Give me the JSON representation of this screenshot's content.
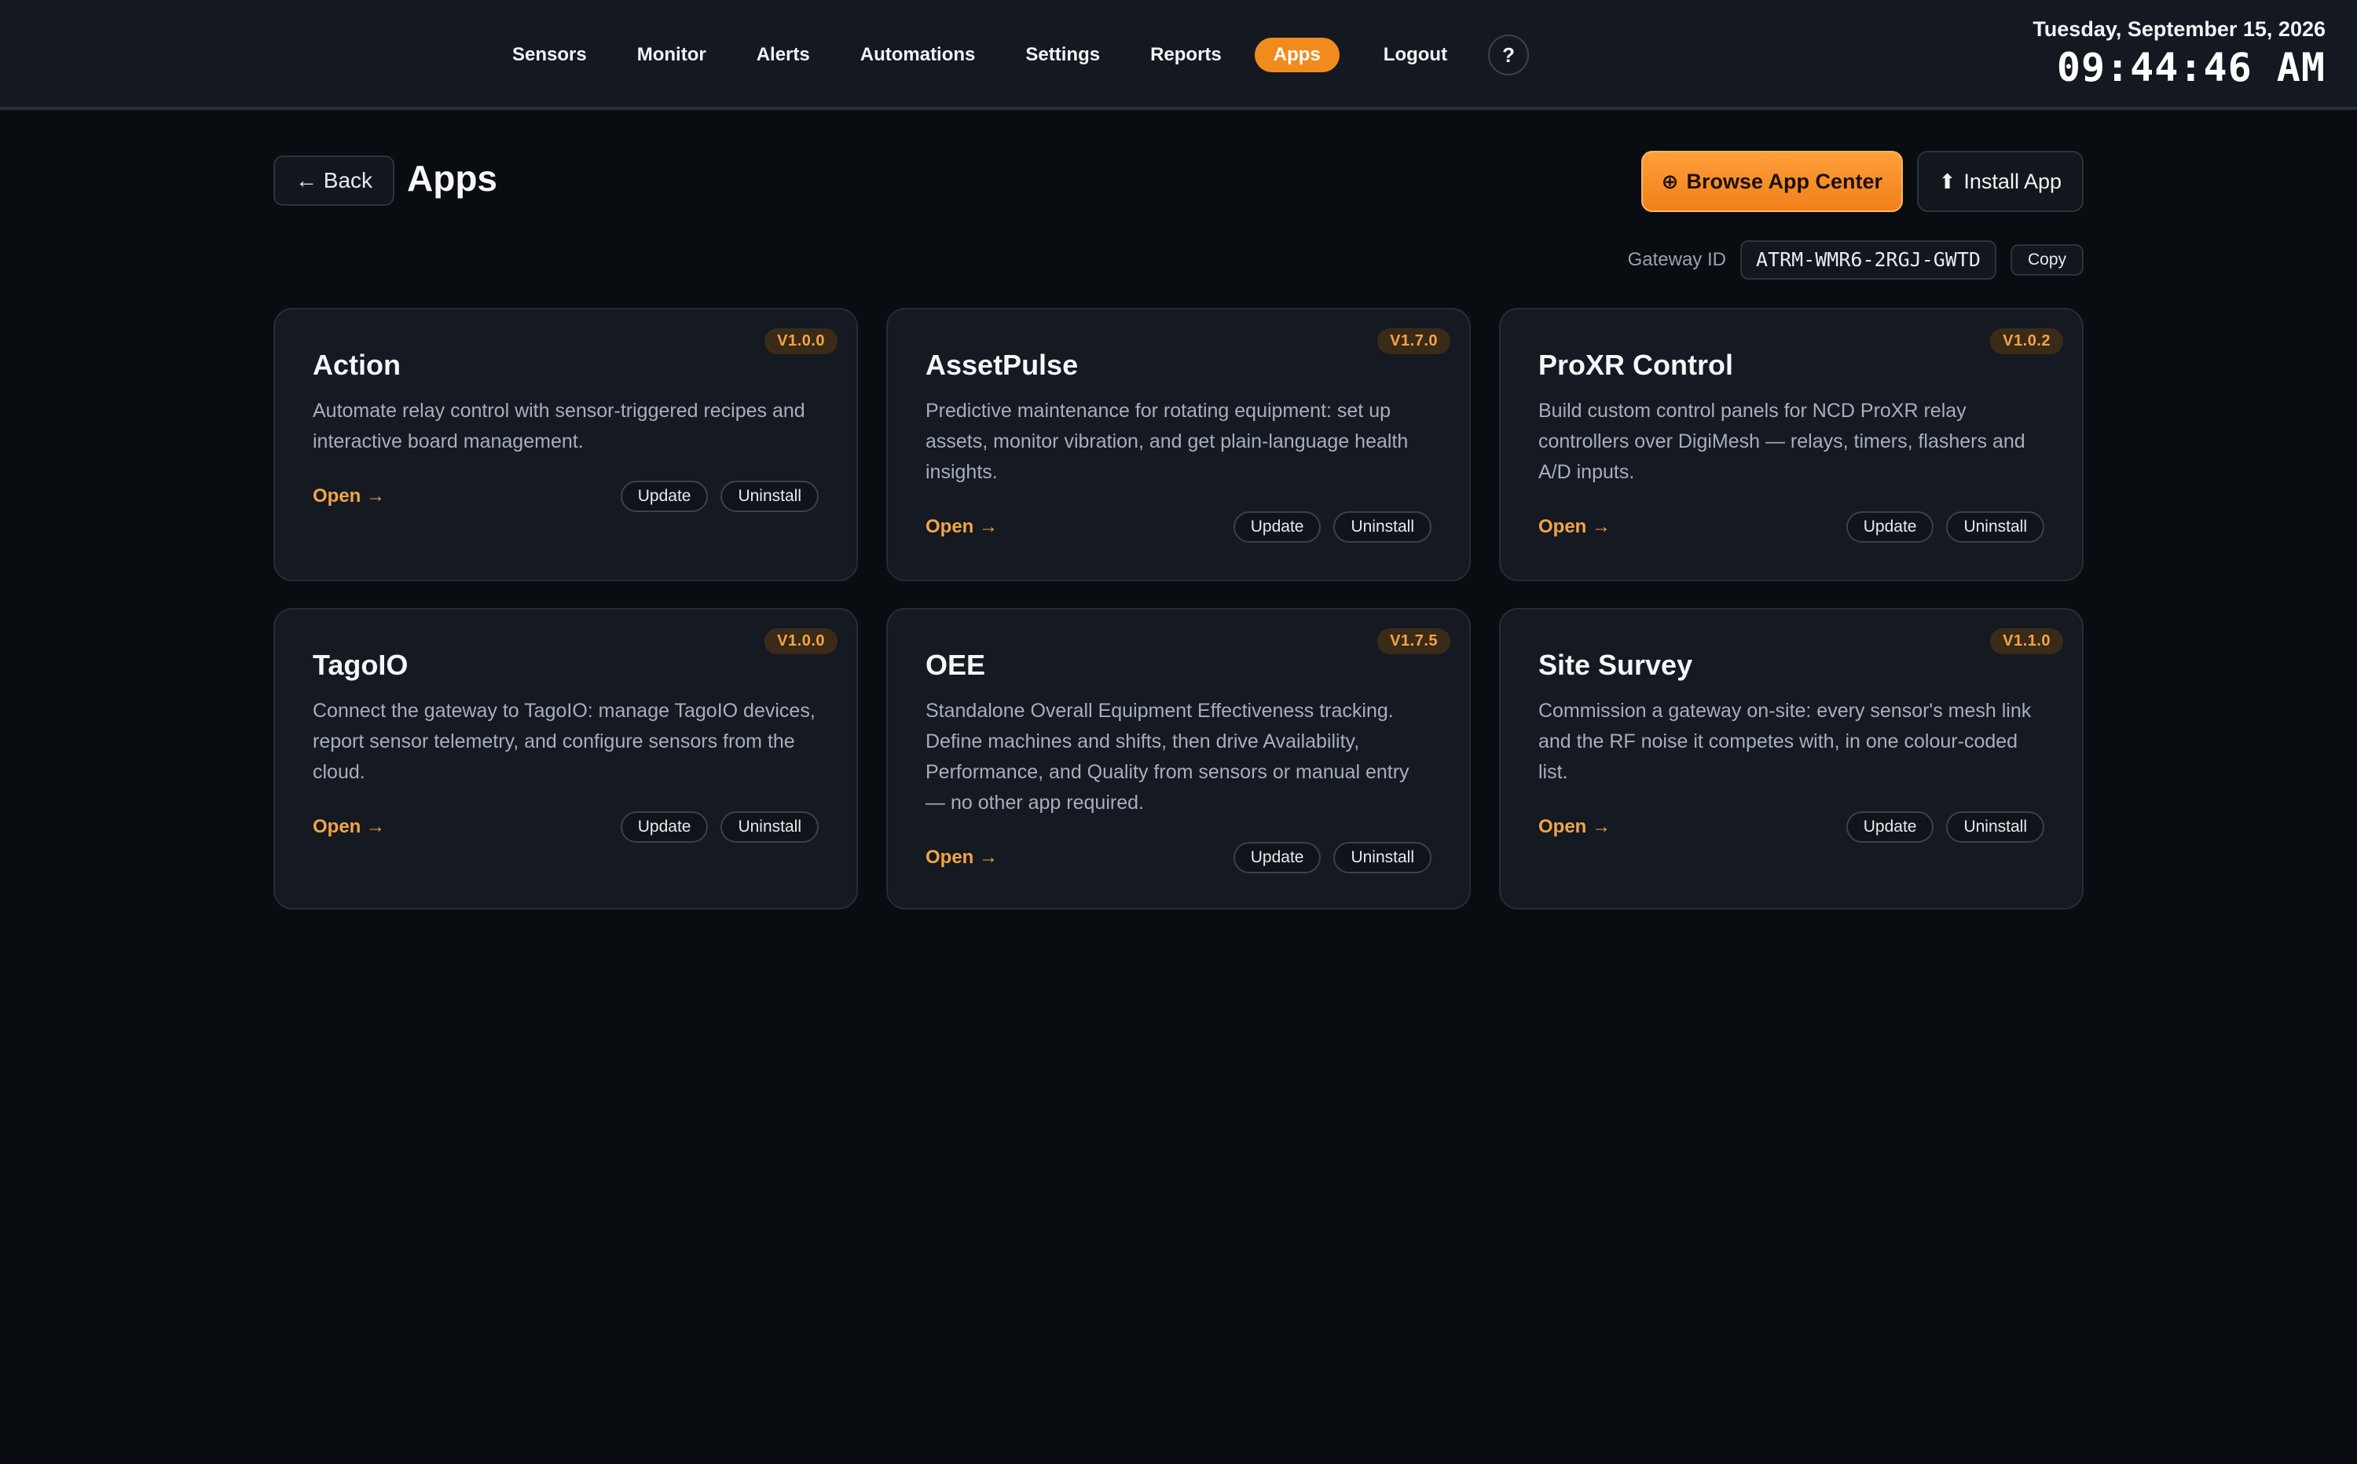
{
  "nav": {
    "items": [
      {
        "label": "Sensors"
      },
      {
        "label": "Monitor"
      },
      {
        "label": "Alerts"
      },
      {
        "label": "Automations"
      },
      {
        "label": "Settings"
      },
      {
        "label": "Reports"
      },
      {
        "label": "Apps",
        "active": true
      },
      {
        "label": "Logout"
      }
    ],
    "help_label": "?"
  },
  "clock": {
    "date": "Tuesday, September 15, 2026",
    "time": "09:44:46 AM"
  },
  "header": {
    "back_label": "← Back",
    "title": "Apps",
    "browse_icon": "⊕",
    "browse_label": "Browse App Center",
    "install_icon": "⬆",
    "install_label": "Install App"
  },
  "gateway": {
    "label": "Gateway ID",
    "value": "ATRM-WMR6-2RGJ-GWTD",
    "copy_label": "Copy"
  },
  "apps": [
    {
      "version": "V1.0.0",
      "title": "Action",
      "description": "Automate relay control with sensor-triggered recipes and interactive board management.",
      "open_label": "Open →",
      "update_label": "Update",
      "uninstall_label": "Uninstall"
    },
    {
      "version": "V1.7.0",
      "title": "AssetPulse",
      "description": "Predictive maintenance for rotating equipment: set up assets, monitor vibration, and get plain-language health insights.",
      "open_label": "Open →",
      "update_label": "Update",
      "uninstall_label": "Uninstall"
    },
    {
      "version": "V1.0.2",
      "title": "ProXR Control",
      "description": "Build custom control panels for NCD ProXR relay controllers over DigiMesh — relays, timers, flashers and A/D inputs.",
      "open_label": "Open →",
      "update_label": "Update",
      "uninstall_label": "Uninstall"
    },
    {
      "version": "V1.0.0",
      "title": "TagoIO",
      "description": "Connect the gateway to TagoIO: manage TagoIO devices, report sensor telemetry, and configure sensors from the cloud.",
      "open_label": "Open →",
      "update_label": "Update",
      "uninstall_label": "Uninstall"
    },
    {
      "version": "V1.7.5",
      "title": "OEE",
      "description": "Standalone Overall Equipment Effectiveness tracking. Define machines and shifts, then drive Availability, Performance, and Quality from sensors or manual entry — no other app required.",
      "open_label": "Open →",
      "update_label": "Update",
      "uninstall_label": "Uninstall"
    },
    {
      "version": "V1.1.0",
      "title": "Site Survey",
      "description": "Commission a gateway on-site: every sensor's mesh link and the RF noise it competes with, in one colour-coded list.",
      "open_label": "Open →",
      "update_label": "Update",
      "uninstall_label": "Uninstall"
    }
  ],
  "colors": {
    "accent": "#f28b1e",
    "background": "#090c10",
    "card": "#141922"
  }
}
